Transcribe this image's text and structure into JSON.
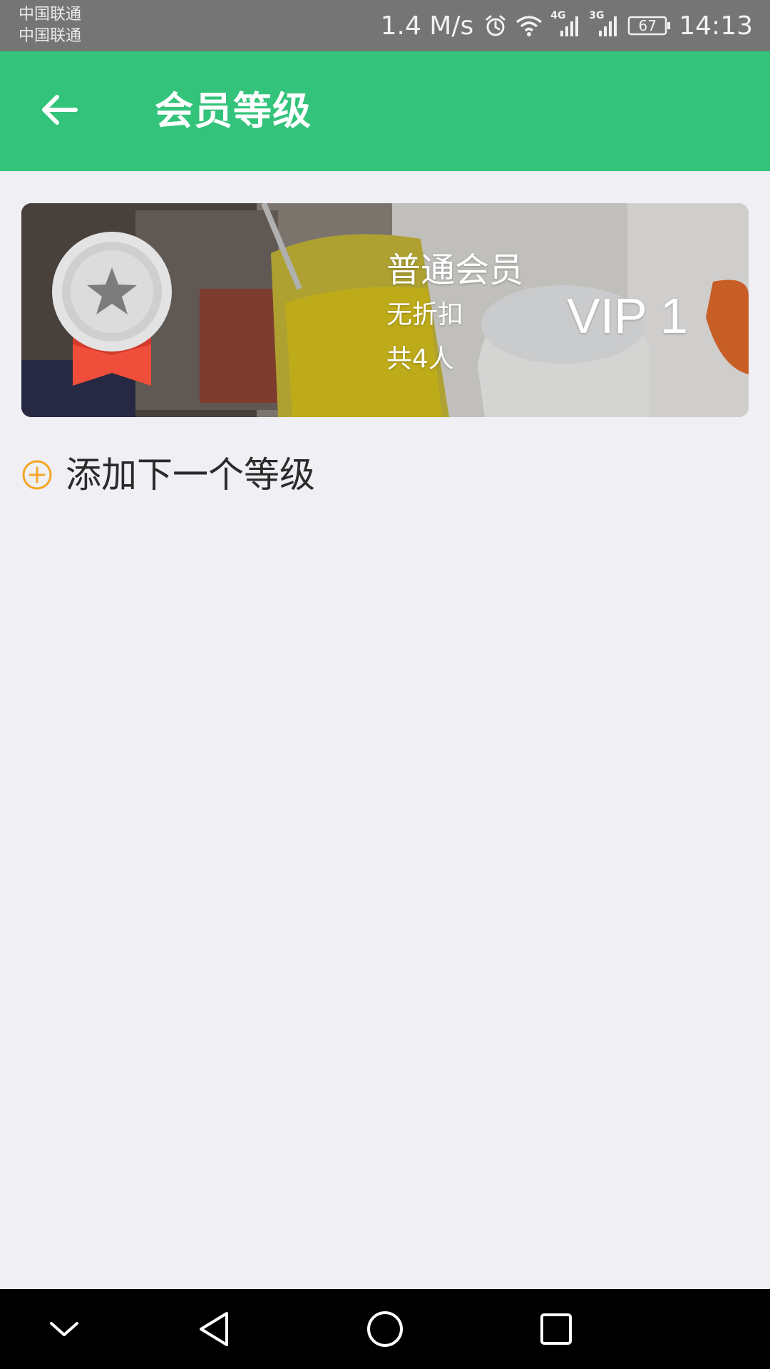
{
  "status_bar": {
    "carrier_1": "中国联通",
    "carrier_2": "中国联通",
    "net_speed": "1.4 M/s",
    "signal_1_type": "4G",
    "signal_2_type": "3G",
    "battery": "67",
    "time": "14:13",
    "icons": [
      "alarm-icon",
      "wifi-icon",
      "signal-4g-icon",
      "signal-3g-icon",
      "battery-icon"
    ]
  },
  "app_bar": {
    "title": "会员等级",
    "back_icon": "arrow-left-icon",
    "color": "#33c37a"
  },
  "member_card": {
    "badge_icon": "silver-star-medal-icon",
    "name": "普通会员",
    "discount": "无折扣",
    "member_count": "共4人",
    "level": "VIP 1"
  },
  "add_tier": {
    "icon": "plus-circle-icon",
    "label": "添加下一个等级",
    "accent": "#f5a623"
  },
  "nav_bar": {
    "buttons": [
      "chevron-down-icon",
      "back-triangle-icon",
      "home-circle-icon",
      "recents-square-icon"
    ]
  }
}
